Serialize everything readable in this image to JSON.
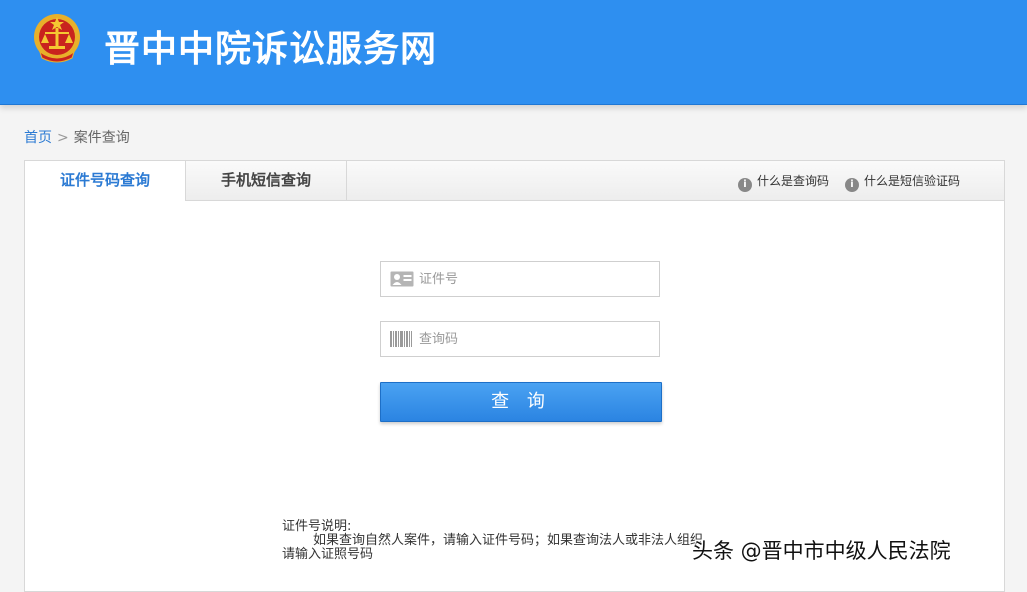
{
  "header": {
    "site_title": "晋中中院诉讼服务网",
    "emblem_icon": "court-emblem-icon"
  },
  "breadcrumb": {
    "home": "首页",
    "separator": ">",
    "current": "案件查询"
  },
  "tabs": [
    {
      "label": "证件号码查询",
      "active": true
    },
    {
      "label": "手机短信查询",
      "active": false
    }
  ],
  "help_links": [
    {
      "icon": "info-icon",
      "label": "什么是查询码"
    },
    {
      "icon": "info-icon",
      "label": "什么是短信验证码"
    }
  ],
  "form": {
    "id_field": {
      "placeholder": "证件号",
      "value": "",
      "icon": "id-card-icon"
    },
    "code_field": {
      "placeholder": "查询码",
      "value": "",
      "icon": "barcode-icon"
    },
    "submit_label": "查 询"
  },
  "note": {
    "title": "证件号说明:",
    "line1": "如果查询自然人案件，请输入证件号码；如果查询法人或非法人组织",
    "line2": "请输入证照号码"
  },
  "watermark": "头条 @晋中市中级人民法院",
  "colors": {
    "header_bg": "#2e8ff0",
    "accent": "#2b7ad3",
    "button": "#3590e8"
  }
}
